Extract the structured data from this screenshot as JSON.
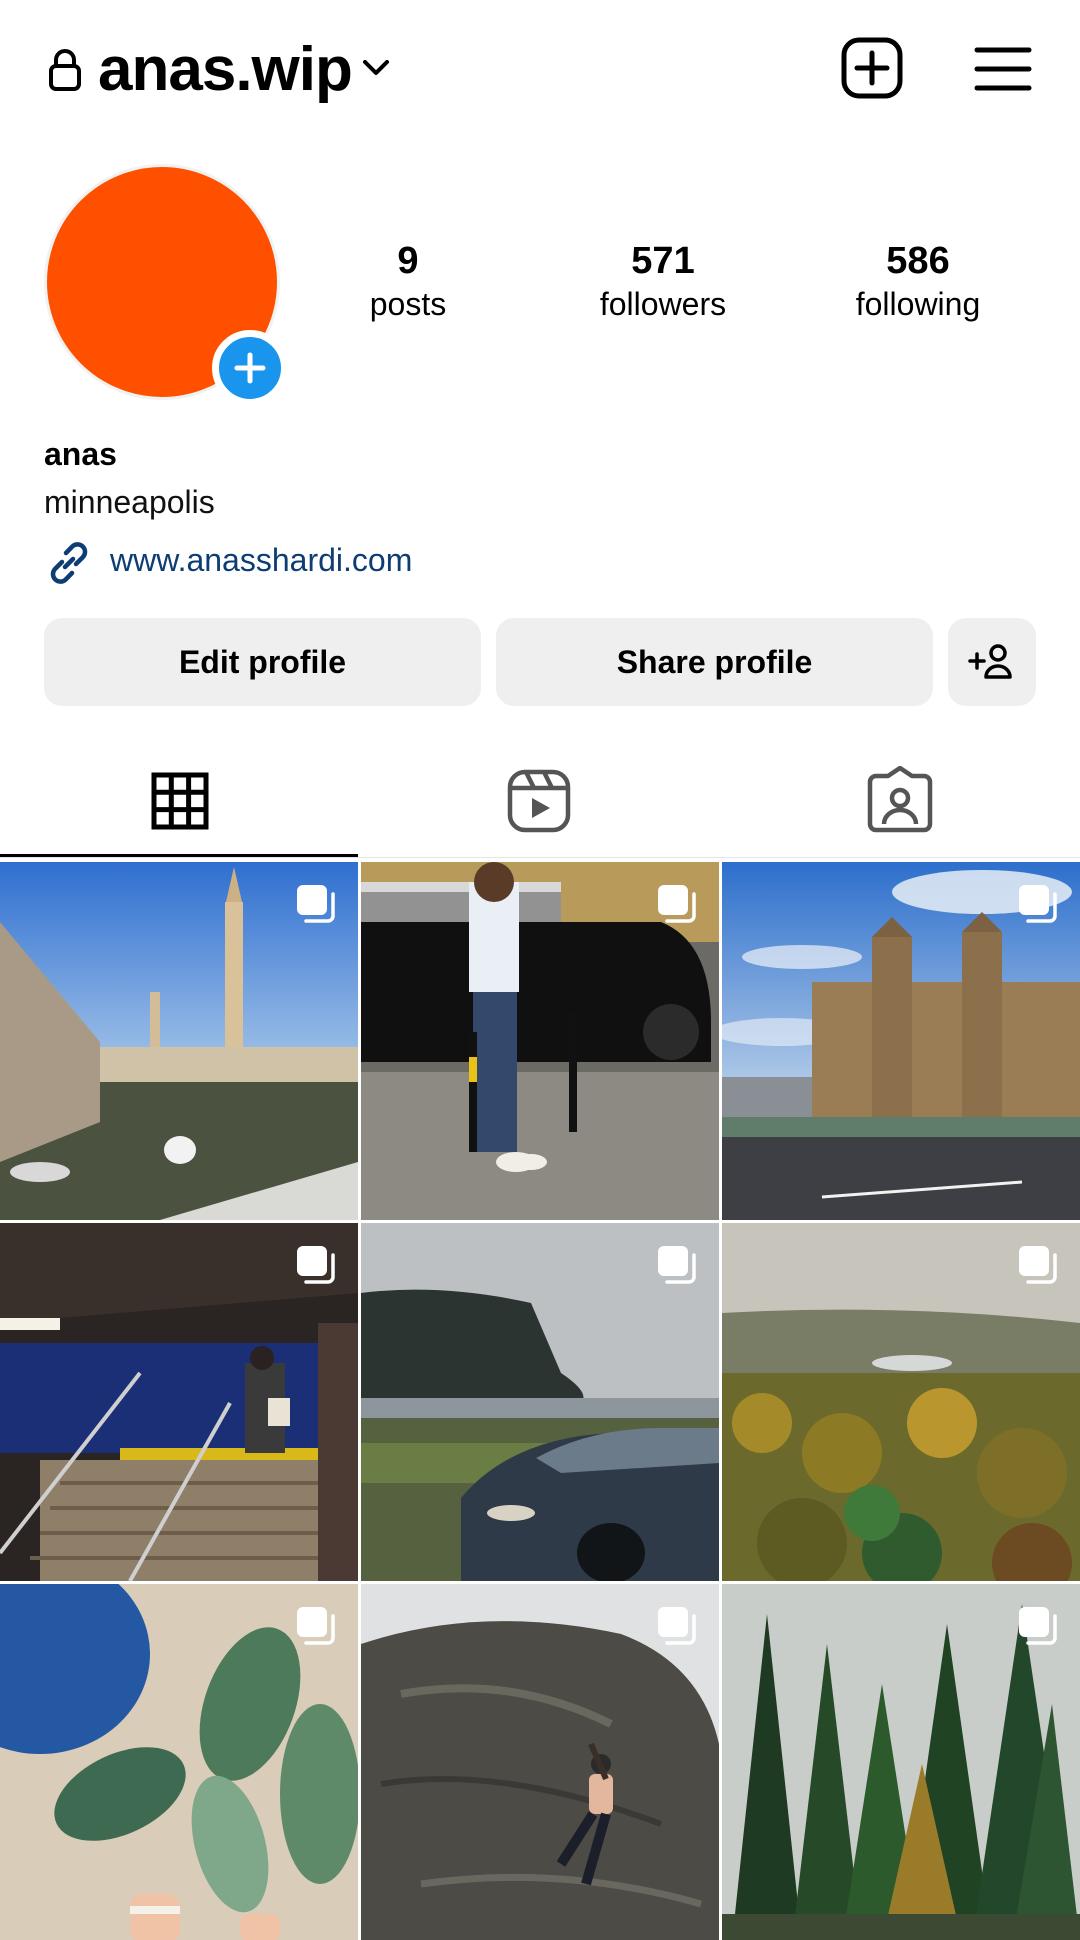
{
  "header": {
    "username": "anas.wip",
    "icons": [
      "lock-icon",
      "chevron-down-icon",
      "new-post-icon",
      "menu-icon"
    ]
  },
  "profile": {
    "avatar_color": "#ff5000",
    "stats": {
      "posts": {
        "value": "9",
        "label": "posts"
      },
      "followers": {
        "value": "571",
        "label": "followers"
      },
      "following": {
        "value": "586",
        "label": "following"
      }
    },
    "name": "anas",
    "location": "minneapolis",
    "website": "www.anasshardi.com"
  },
  "actions": {
    "edit_label": "Edit profile",
    "share_label": "Share profile",
    "discover_icon": "add-person-icon"
  },
  "tabs": [
    {
      "name": "posts-grid",
      "icon": "grid-icon",
      "active": true
    },
    {
      "name": "reels",
      "icon": "reels-icon",
      "active": false
    },
    {
      "name": "tagged",
      "icon": "tagged-icon",
      "active": false
    }
  ],
  "posts": [
    {
      "subject": "mosque courtyard with minaret",
      "multi": true
    },
    {
      "subject": "man leaning on black car",
      "multi": true
    },
    {
      "subject": "parliament building by river",
      "multi": true
    },
    {
      "subject": "subway stairs",
      "multi": true
    },
    {
      "subject": "car by misty lake",
      "multi": true
    },
    {
      "subject": "autumn forest valley",
      "multi": true
    },
    {
      "subject": "plant leaves and blue chair",
      "multi": true
    },
    {
      "subject": "person climbing boulder",
      "multi": true
    },
    {
      "subject": "pine forest",
      "multi": true
    }
  ],
  "colors": {
    "accent_blue": "#1a95ee",
    "link": "#0d3d73",
    "button_bg": "#efefef"
  }
}
